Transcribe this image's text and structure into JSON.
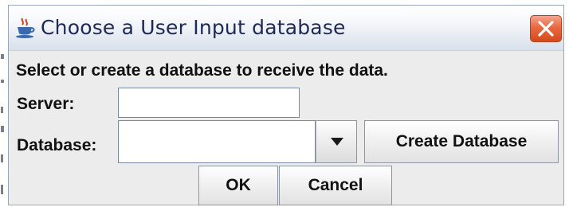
{
  "dialog": {
    "title": "Choose a User Input database",
    "icon": "java-coffee-cup-icon",
    "close_icon": "close-x-icon",
    "accent_color": "#e8693f"
  },
  "form": {
    "instruction": "Select or create a database to receive the data.",
    "server_label": "Server:",
    "server_value": "",
    "database_label": "Database:",
    "database_value": "",
    "dropdown_icon": "triangle-down-icon"
  },
  "buttons": {
    "create_database": "Create Database",
    "ok": "OK",
    "cancel": "Cancel"
  }
}
